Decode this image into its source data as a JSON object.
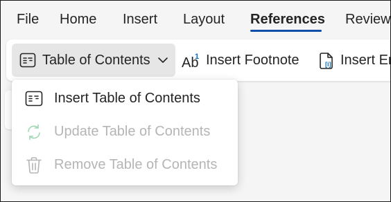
{
  "menubar": {
    "items": [
      {
        "label": "File",
        "active": false
      },
      {
        "label": "Home",
        "active": false
      },
      {
        "label": "Insert",
        "active": false
      },
      {
        "label": "Layout",
        "active": false
      },
      {
        "label": "References",
        "active": true
      },
      {
        "label": "Review",
        "active": false
      }
    ],
    "accent_color": "#0f4fa8"
  },
  "ribbon": {
    "toc_button": {
      "label": "Table of Contents",
      "icon": "table-of-contents-icon",
      "chevron": "chevron-down-icon"
    },
    "footnote_button": {
      "label": "Insert Footnote",
      "icon": "footnote-icon"
    },
    "endnote_button": {
      "label": "Insert En",
      "icon": "endnote-icon"
    }
  },
  "dropdown": {
    "items": [
      {
        "label": "Insert Table of Contents",
        "icon": "table-of-contents-icon",
        "enabled": true
      },
      {
        "label": "Update Table of Contents",
        "icon": "refresh-icon",
        "enabled": false
      },
      {
        "label": "Remove Table of Contents",
        "icon": "trash-icon",
        "enabled": false
      }
    ]
  },
  "colors": {
    "text": "#242424",
    "disabled_text": "#b5b5b5",
    "disabled_icon_green": "#9fd6b3",
    "background": "#f5f5f5"
  }
}
